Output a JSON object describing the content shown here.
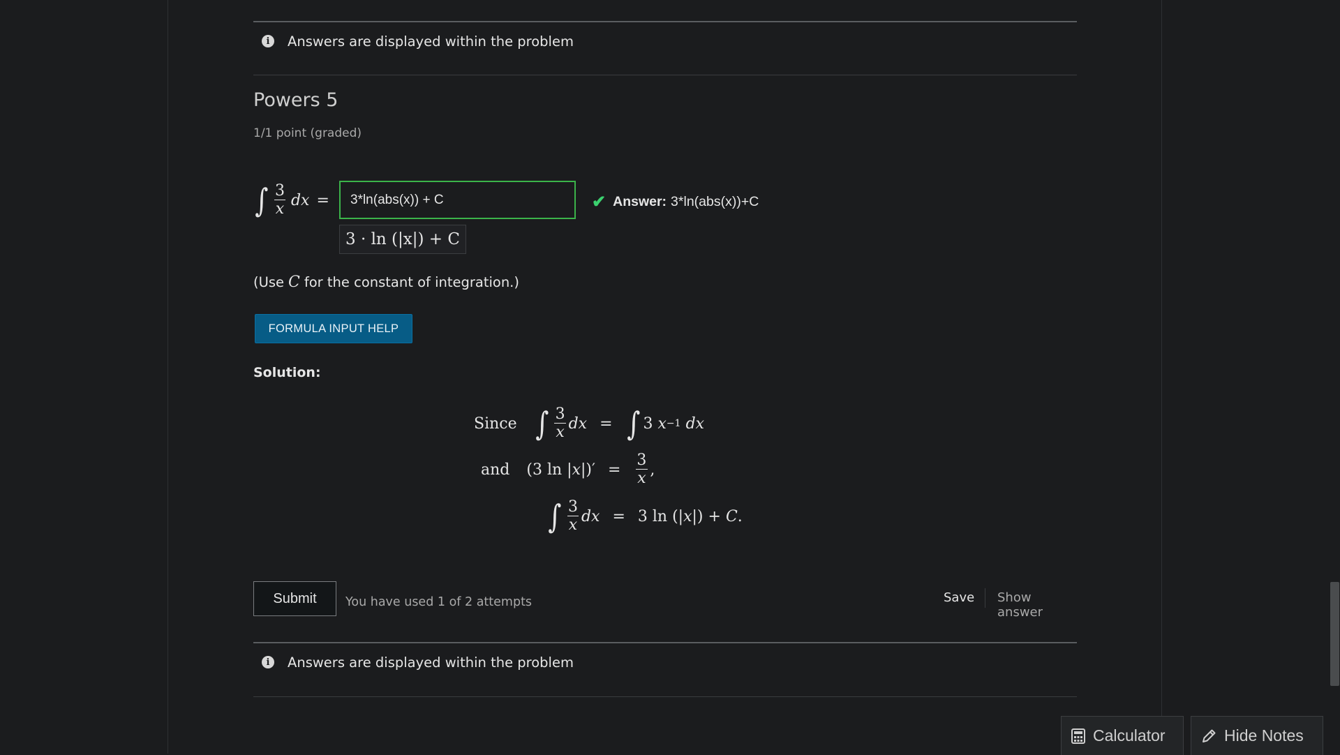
{
  "notices": {
    "top": "Answers are displayed within the problem",
    "bottom": "Answers are displayed within the problem"
  },
  "problem": {
    "title": "Powers 5",
    "progress": "1/1 point (graded)",
    "input_value": "3*ln(abs(x)) + C",
    "preview_text": "3 · ln (|x|) + C",
    "answer_label": "Answer:",
    "answer_value": "3*ln(abs(x))+C",
    "hint_prefix": "(Use",
    "hint_var": "C",
    "hint_suffix": "for the constant of integration.)",
    "formula_help_label": "FORMULA INPUT HELP",
    "solution_label": "Solution:",
    "solution": {
      "since": "Since",
      "and": "and"
    }
  },
  "actions": {
    "submit_label": "Submit",
    "attempts_text": "You have used 1 of 2 attempts",
    "save_label": "Save",
    "show_answer_label": "Show answer"
  },
  "tools": {
    "calculator_label": "Calculator",
    "hide_notes_label": "Hide Notes"
  },
  "icons": [
    "info-icon",
    "check-icon",
    "calculator-icon",
    "pencil-icon"
  ],
  "colors": {
    "background": "#1b1c1e",
    "correct_green": "#3bb44a",
    "help_button_blue": "#075c86"
  }
}
